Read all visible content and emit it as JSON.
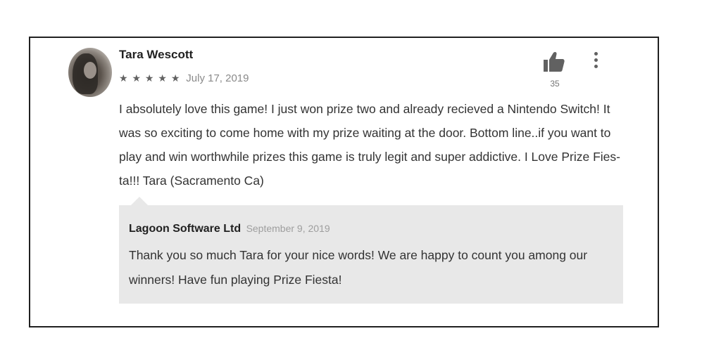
{
  "review": {
    "author": "Tara Wescott",
    "rating": 5,
    "stars": [
      "★",
      "★",
      "★",
      "★",
      "★"
    ],
    "date": "July 17, 2019",
    "text": "I absolutely love this game! I just won prize two and already recieved a Nintendo Switch! It was so exciting to come home with my prize waiting at the door. Bottom line..if you want to play and win worthwhile prizes this game is truly legit and super addictive. I Love Prize Fies-ta!!! Tara (Sacramento Ca)",
    "helpful_count": "35",
    "icons": {
      "like": "thumbs-up-icon",
      "menu": "more-vertical-icon",
      "avatar": "user-avatar"
    }
  },
  "developer_reply": {
    "author": "Lagoon Software Ltd",
    "date": "September 9, 2019",
    "text": "Thank you so much Tara for your nice words! We are happy to count you among our winners! Have fun playing Prize Fiesta!"
  },
  "colors": {
    "text_primary": "#212121",
    "text_body": "#333333",
    "text_muted": "#8a8a8a",
    "reply_background": "#e8e8e8",
    "card_border": "#202020"
  }
}
